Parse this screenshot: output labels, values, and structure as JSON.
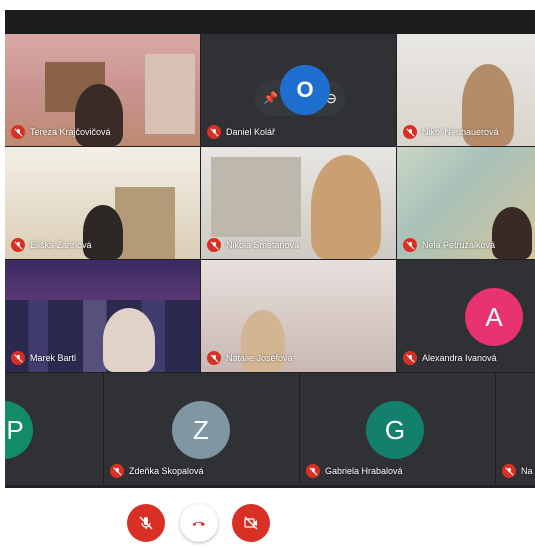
{
  "participants": [
    {
      "name": "Tereza Krajčovičová"
    },
    {
      "name": "Daniel Kolář"
    },
    {
      "name": "Nikol Neubauerová"
    },
    {
      "name": "Eliška Zahnová"
    },
    {
      "name": "Nikola Smetanová"
    },
    {
      "name": "Nela Petružálková"
    },
    {
      "name": "Marek Bartl"
    },
    {
      "name": "Natálie Josefová"
    },
    {
      "name": "Alexandra Ivanová",
      "initial": "A",
      "color": "#e8336e"
    },
    {
      "name": "",
      "initial": "P",
      "color": "#128c66"
    },
    {
      "name": "Zdeňka Skopalová",
      "initial": "Z",
      "color": "#7f97a2"
    },
    {
      "name": "Gabriela Hrabalová",
      "initial": "G",
      "color": "#12806a"
    },
    {
      "name": "Na"
    }
  ],
  "controls": {
    "mic_icon": "mic-off-icon",
    "hangup_icon": "phone-hangup-icon",
    "camera_icon": "camera-off-icon",
    "accent_red": "#d93025"
  },
  "overlay": {
    "app_icon": "outlook-icon",
    "initial": "O"
  }
}
